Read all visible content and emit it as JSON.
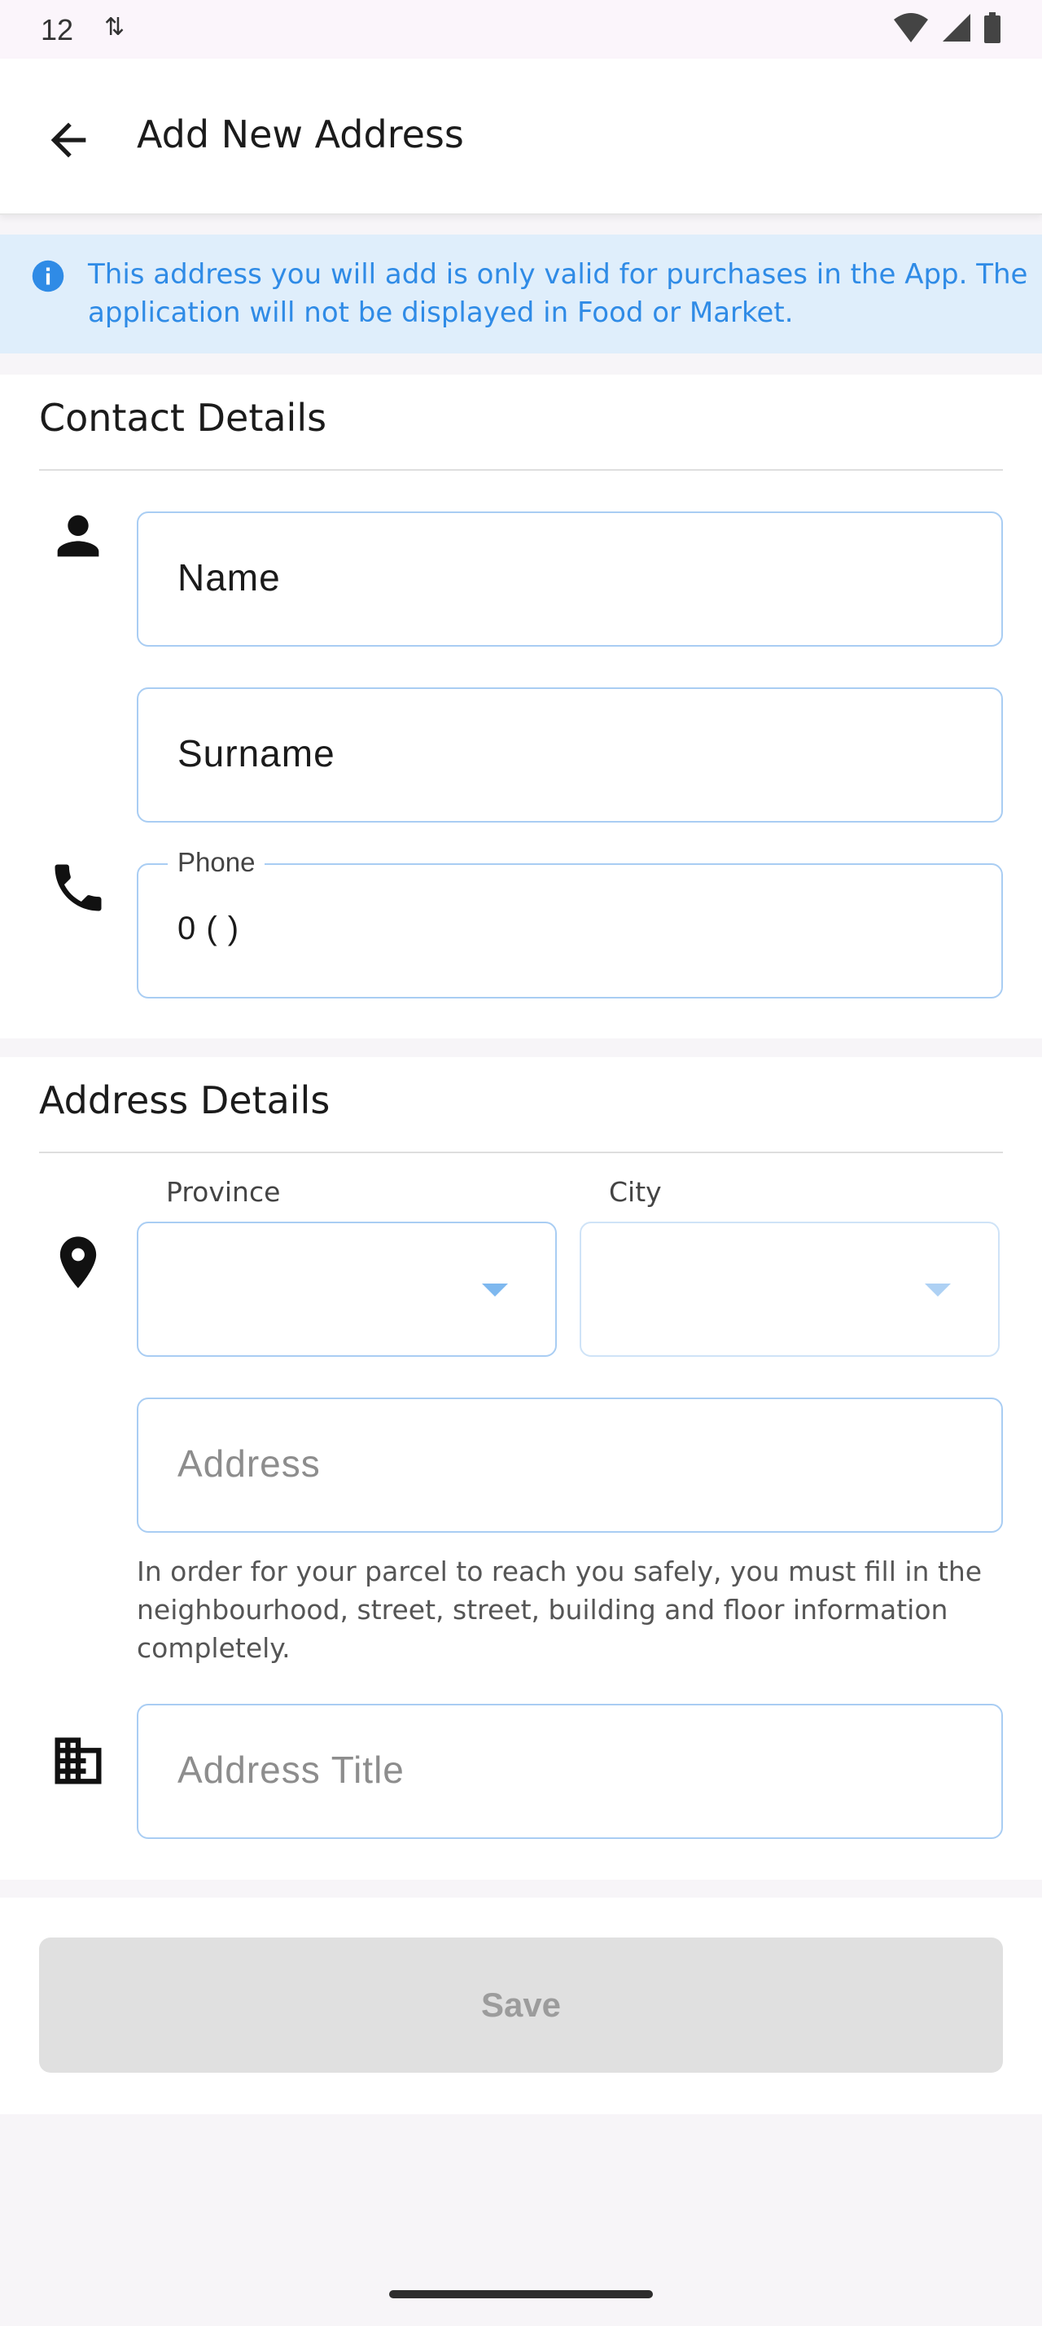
{
  "status_bar": {
    "time": "12",
    "sync_glyph": "⇅"
  },
  "app_bar": {
    "title": "Add New Address"
  },
  "info_banner": {
    "text": "This address you will add is only valid for purchases in the App. The application will not be displayed in Food or Market.",
    "accent_color": "#2f8be6"
  },
  "contact": {
    "title": "Contact Details",
    "name_value": "Name",
    "surname_value": "Surname",
    "phone_label": "Phone",
    "phone_value": "0 (   )"
  },
  "address": {
    "title": "Address Details",
    "province_label": "Province",
    "city_label": "City",
    "address_placeholder": "Address",
    "helper_text": "In order for your parcel to reach you safely, you must fill in the neighbourhood, street, street, building and floor information completely.",
    "address_title_placeholder": "Address Title"
  },
  "actions": {
    "save_label": "Save"
  },
  "icons": [
    "back-arrow-icon",
    "info-icon",
    "person-icon",
    "phone-icon",
    "location-pin-icon",
    "building-icon",
    "wifi-icon",
    "signal-icon",
    "battery-icon"
  ]
}
